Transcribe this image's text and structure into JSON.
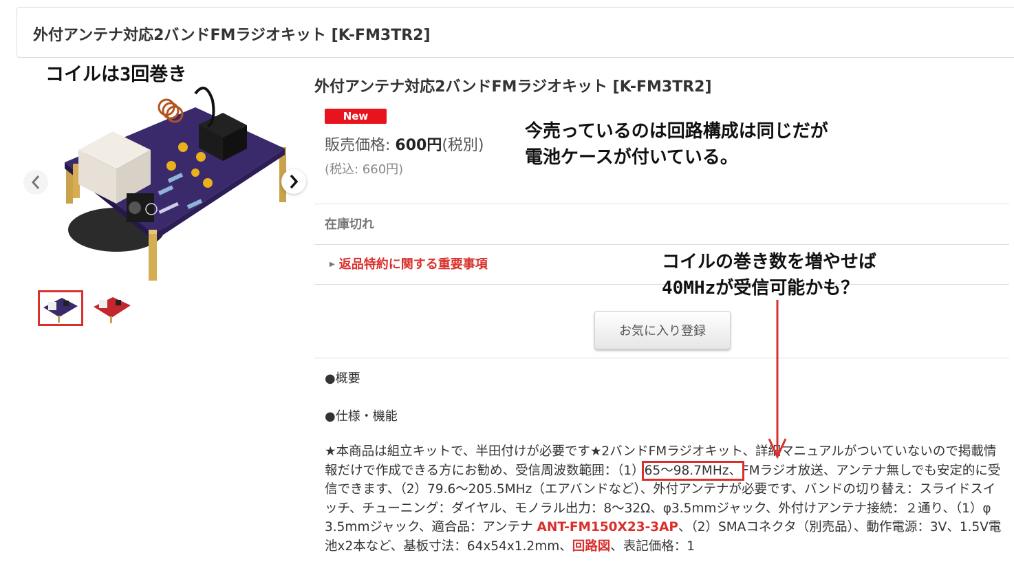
{
  "header": {
    "title": "外付アンテナ対応2バンドFMラジオキット [K-FM3TR2]"
  },
  "annotations": {
    "coil": "コイルは3回巻き",
    "current_line1": "今売っているのは回路構成は同じだが",
    "current_line2": "電池ケースが付いている。",
    "more_turns_line1": "コイルの巻き数を増やせば",
    "more_turns_line2": "40MHzが受信可能かも？"
  },
  "gallery": {
    "prev_icon": "chevron-left-icon",
    "next_icon": "chevron-right-icon",
    "thumbnail_count": 2,
    "selected_thumbnail": 1
  },
  "product": {
    "title": "外付アンテナ対応2バンドFMラジオキット [K-FM3TR2]",
    "badge": "New",
    "price_label": "販売価格: ",
    "price": "600円",
    "price_suffix": "(税別)",
    "tax_included": "(税込: 660円)",
    "stock": "在庫切れ",
    "return_policy": "返品特約に関する重要事項",
    "favorite_button": "お気に入り登録",
    "section_overview": "●概要",
    "section_specs": "●仕様・機能"
  },
  "description": {
    "part1": "★本商品は組立キットで、半田付けが必要です★2バンドFMラジオキット、詳細マニュアルがついていないので掲載情報だけで作成できる方にお勧め、受信周波数範囲：（1）",
    "highlight": "65～98.7MHz、",
    "part2": "FMラジオ放送、アンテナ無しでも安定的に受信できます、（2）79.6～205.5MHz（エアバンドなど）、外付アンテナが必要です、バンドの切り替え：スライドスイッチ、チューニング：ダイヤル、モノラル出力：8～32Ω、φ3.5mmジャック、外付けアンテナ接続：２通り、（1）φ3.5mmジャック、適合品：アンテナ ",
    "antenna_link": "ANT-FM150X23-3AP",
    "part3": "、（2）SMAコネクタ（別売品）、動作電源：3V、1.5V電池x2本など、基板寸法：64x54x1.2mm、",
    "schematic_link": "回路図",
    "part4": "、表記価格：1"
  },
  "colors": {
    "accent_red": "#d9302c",
    "badge_red": "#e8141d",
    "pcb_purple": "#3b2a6b"
  }
}
